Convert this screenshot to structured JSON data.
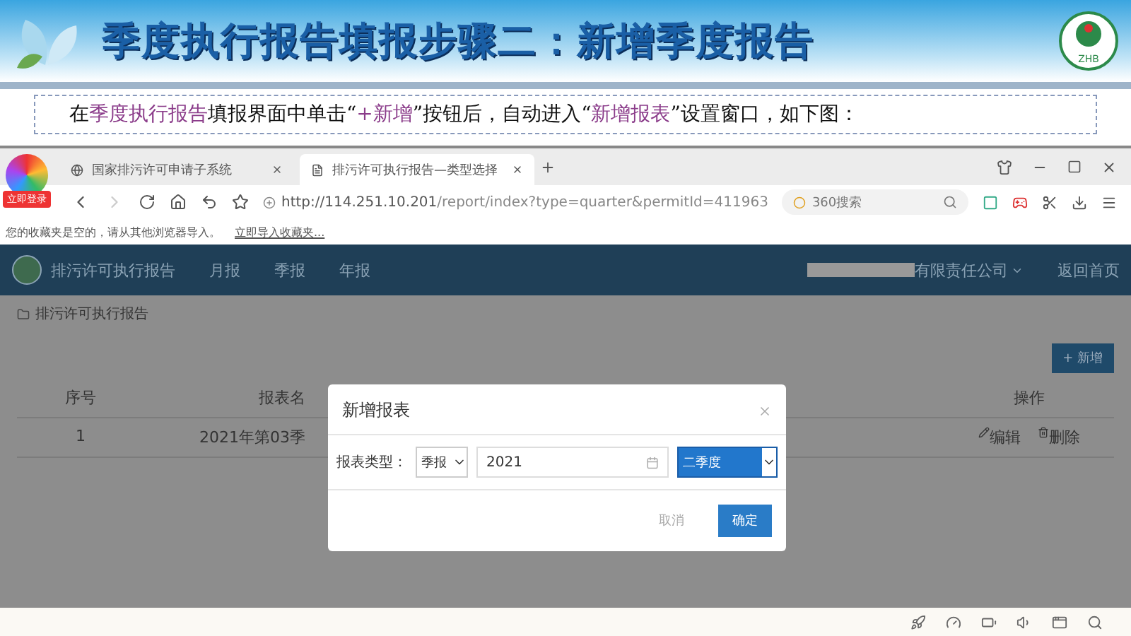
{
  "slide": {
    "title": "季度执行报告填报步骤二：新增季度报告",
    "logo_text": "ZHB",
    "instruction": [
      {
        "text": "在",
        "highlight": false
      },
      {
        "text": "季度执行报告",
        "highlight": true
      },
      {
        "text": "填报界面中单击“",
        "highlight": false
      },
      {
        "text": "+新增",
        "highlight": true
      },
      {
        "text": "”按钮后，自动进入“",
        "highlight": false
      },
      {
        "text": "新增报表",
        "highlight": true
      },
      {
        "text": "”设置窗口，如下图：",
        "highlight": false
      }
    ]
  },
  "browser": {
    "login_badge": "立即登录",
    "tabs": [
      {
        "label": "国家排污许可申请子系统",
        "selected": false
      },
      {
        "label": "排污许可执行报告—类型选择",
        "selected": true
      }
    ],
    "url_host": "http://114.251.10.201",
    "url_path": "/report/index?type=quarter&permitId=411963",
    "search": {
      "placeholder": "360搜索"
    },
    "bookmark_notice": "您的收藏夹是空的，请从其他浏览器导入。",
    "bookmark_link": "立即导入收藏夹..."
  },
  "app": {
    "title": "排污许可执行报告",
    "nav": [
      "月报",
      "季报",
      "年报"
    ],
    "company": "有限责任公司",
    "home_link": "返回首页",
    "breadcrumb": "排污许可执行报告",
    "add_button": "+ 新增",
    "table": {
      "columns": [
        "序号",
        "报表名",
        "操作"
      ],
      "rows": [
        {
          "index": "1",
          "name": "2021年第03季",
          "actions": [
            "编辑",
            "删除"
          ]
        }
      ]
    }
  },
  "dialog": {
    "title": "新增报表",
    "label": "报表类型：",
    "type_value": "季报",
    "year_value": "2021",
    "quarter_value": "二季度",
    "quarter_focused": true,
    "buttons": [
      "取消",
      "确定"
    ]
  }
}
